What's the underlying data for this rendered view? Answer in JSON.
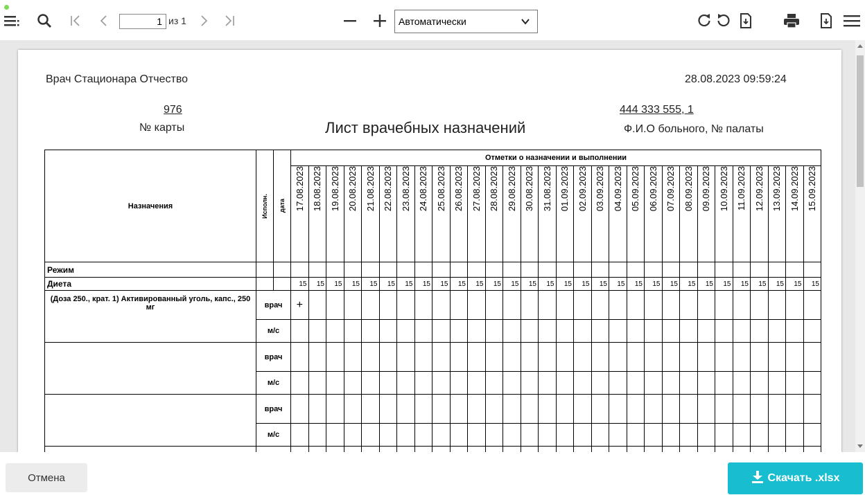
{
  "toolbar": {
    "icons": [
      "sidebar-toggle-icon",
      "search-icon",
      "first-page-icon",
      "prev-page-icon",
      "next-page-icon",
      "last-page-icon",
      "zoom-out-icon",
      "zoom-in-icon",
      "rotate-cw-icon",
      "rotate-ccw-icon",
      "open-file-icon",
      "print-icon",
      "download-icon",
      "menu-icon"
    ],
    "page_value": "1",
    "page_of": "из 1",
    "zoom_value": "Автоматически",
    "status_color": "#7ed957"
  },
  "report": {
    "header_left": "Врач Стационара Отчество",
    "datetime": "28.08.2023 09:59:24",
    "card_number": "976",
    "card_label": "№ карты",
    "title": "Лист врачебных назначений",
    "patient_value": "444 333 555, 1",
    "patient_label": "Ф.И.О больного, № палаты"
  },
  "table": {
    "col_prescriptions": "Назначения",
    "col_performer": "Исполн.",
    "col_date": "дата",
    "marks_header": "Отметки о назначении и выполнении",
    "dates": [
      "17.08.2023",
      "18.08.2023",
      "19.08.2023",
      "20.08.2023",
      "21.08.2023",
      "22.08.2023",
      "23.08.2023",
      "24.08.2023",
      "25.08.2023",
      "26.08.2023",
      "27.08.2023",
      "28.08.2023",
      "29.08.2023",
      "30.08.2023",
      "31.08.2023",
      "01.09.2023",
      "02.09.2023",
      "03.09.2023",
      "04.09.2023",
      "05.09.2023",
      "06.09.2023",
      "07.09.2023",
      "08.09.2023",
      "09.09.2023",
      "10.09.2023",
      "11.09.2023",
      "12.09.2023",
      "13.09.2023",
      "14.09.2023",
      "15.09.2023"
    ],
    "mode_label": "Режим",
    "diet_label": "Диета",
    "diet_value": "15",
    "doctor_label": "врач",
    "nurse_label": "м/с",
    "first_drug": "(Доза 250., крат. 1) Активированный уголь, капс., 250 мг",
    "first_mark": "+"
  },
  "footer": {
    "cancel_label": "Отмена",
    "download_label": "Скачать .xlsx",
    "download_color": "#19bdd0"
  }
}
